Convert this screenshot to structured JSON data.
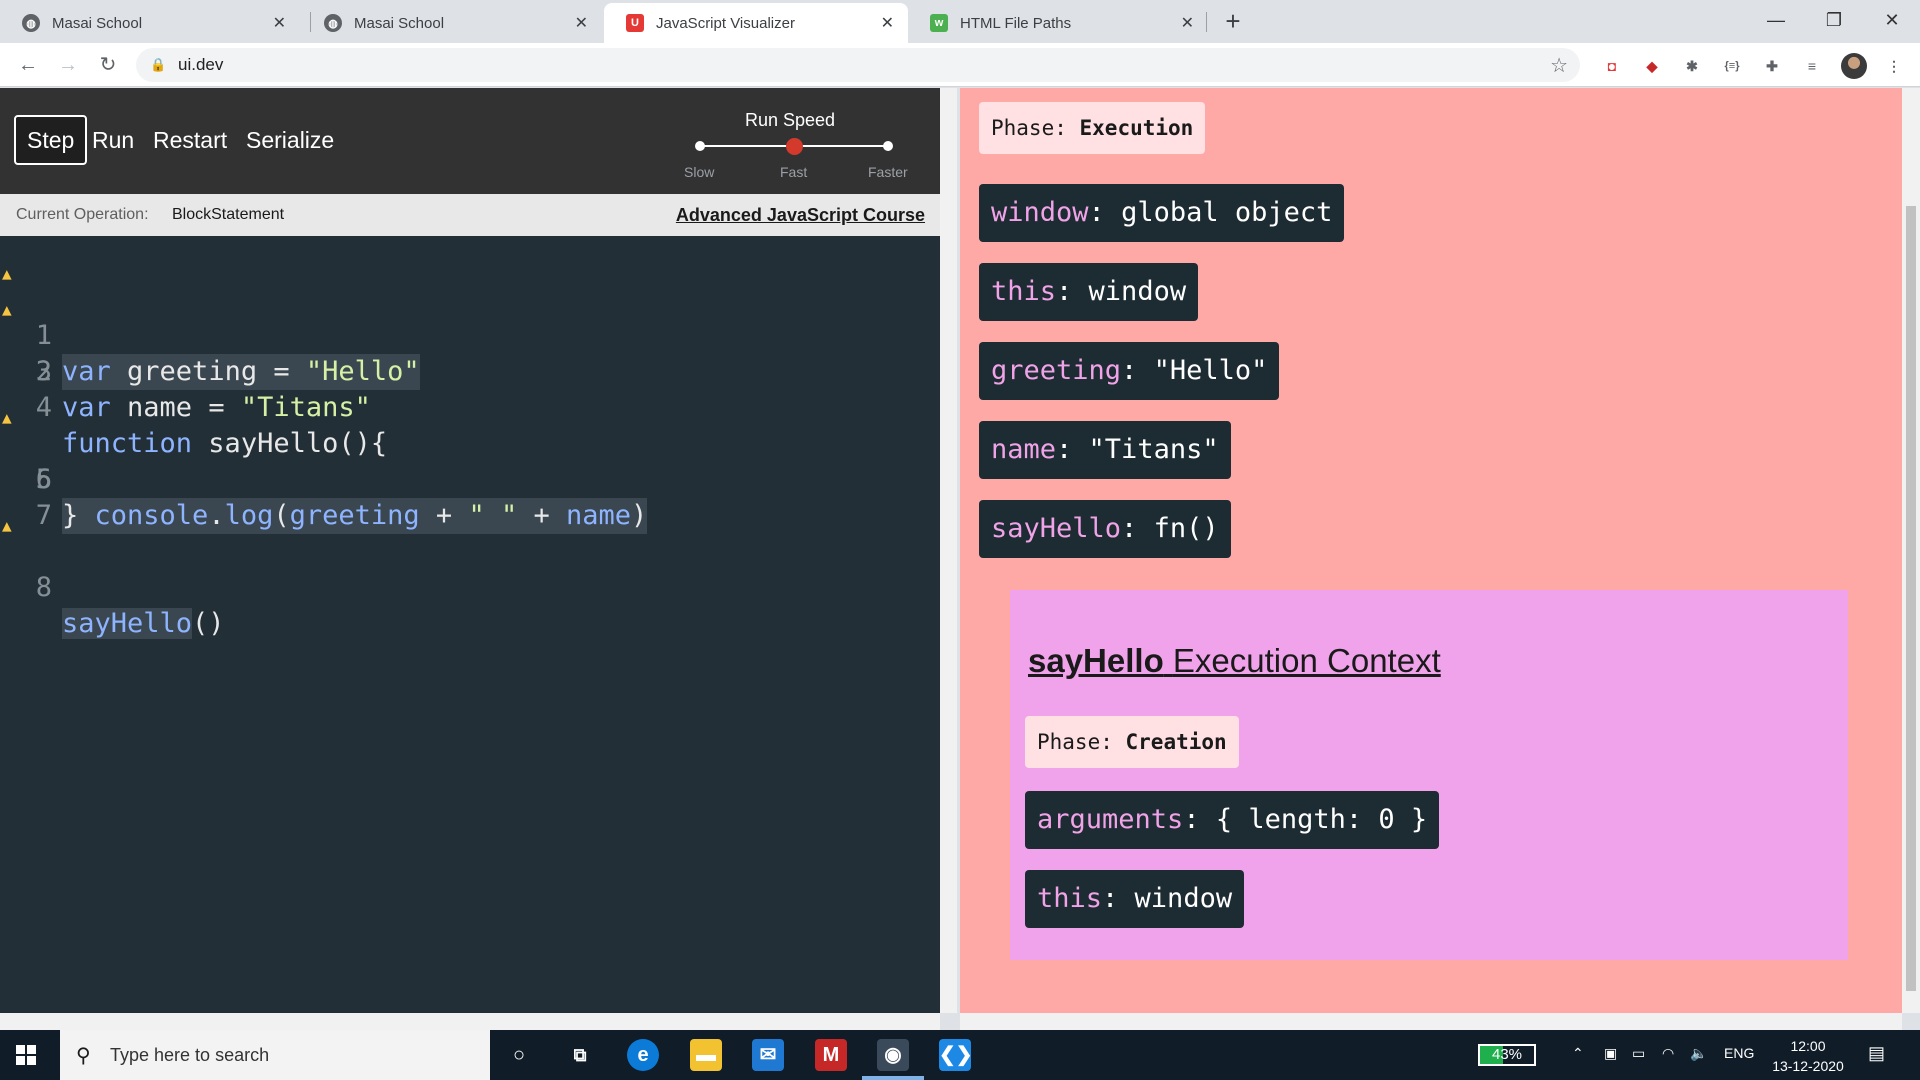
{
  "browser": {
    "tabs": [
      {
        "title": "Masai School",
        "active": false
      },
      {
        "title": "Masai School",
        "active": false
      },
      {
        "title": "JavaScript Visualizer",
        "active": true
      },
      {
        "title": "HTML File Paths",
        "active": false
      }
    ],
    "url": "ui.dev",
    "tab_close": "✕",
    "new_tab": "+"
  },
  "controls": {
    "step": "Step",
    "run": "Run",
    "restart": "Restart",
    "serialize": "Serialize",
    "speed_title": "Run Speed",
    "speed_labels": [
      "Slow",
      "Fast",
      "Faster"
    ],
    "speed_selected": "Fast"
  },
  "opbar": {
    "label": "Current Operation:",
    "value": "BlockStatement",
    "course_link": "Advanced JavaScript Course"
  },
  "code": {
    "line_numbers": [
      "1",
      "2",
      "3",
      "4",
      "5",
      "6",
      "7",
      "8"
    ],
    "warnings_on_lines": [
      "1",
      "2",
      "5",
      "8"
    ]
  },
  "global_context": {
    "phase_label": "Phase:",
    "phase_value": "Execution",
    "vars": [
      {
        "key": "window",
        "value": "global object"
      },
      {
        "key": "this",
        "value": "window"
      },
      {
        "key": "greeting",
        "value": "\"Hello\""
      },
      {
        "key": "name",
        "value": "\"Titans\""
      },
      {
        "key": "sayHello",
        "value": "fn()"
      }
    ]
  },
  "function_context": {
    "name": "sayHello",
    "title_suffix": "Execution Context",
    "phase_label": "Phase:",
    "phase_value": "Creation",
    "vars": [
      {
        "key": "arguments",
        "value": "{ length: 0 }"
      },
      {
        "key": "this",
        "value": "window"
      }
    ]
  },
  "taskbar": {
    "search_placeholder": "Type here to search",
    "battery": "43%",
    "language": "ENG",
    "time": "12:00",
    "date": "13-12-2020"
  },
  "colors": {
    "visual_bg": "#ffa9a7",
    "context_bg": "#f0a3ea",
    "var_bg": "#1d2b33",
    "var_key": "#f0a3e6",
    "editor_bg": "#232f37",
    "slider_thumb": "#d33a2c"
  }
}
